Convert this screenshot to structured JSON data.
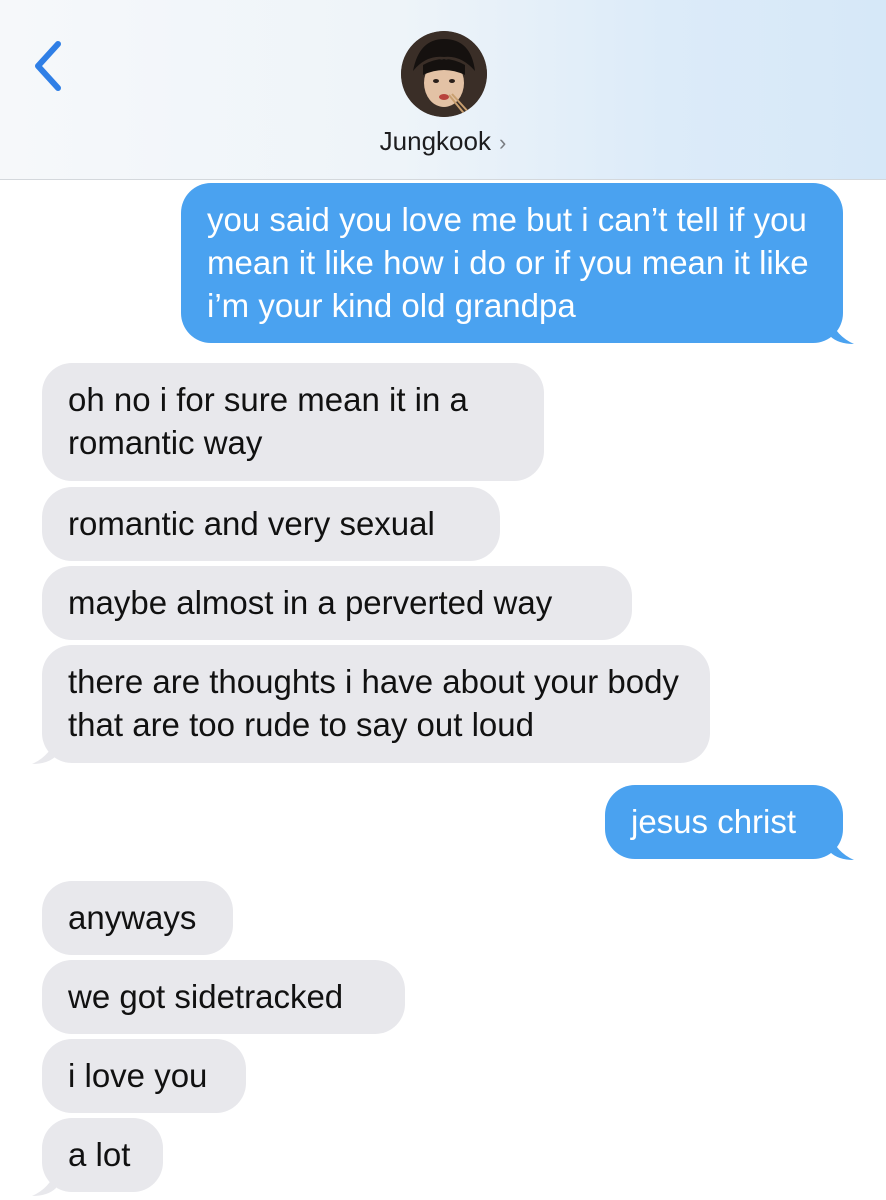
{
  "header": {
    "contact_name": "Jungkook",
    "chevron": "›"
  },
  "messages": [
    {
      "from": "me",
      "text": "you said you love me but i can’t tell if you mean it like how i do or if you mean it like i’m your kind old grandpa"
    },
    {
      "from": "them",
      "text": "oh no i for sure mean it in a romantic way"
    },
    {
      "from": "them",
      "text": "romantic and very sexual"
    },
    {
      "from": "them",
      "text": "maybe almost in a perverted way"
    },
    {
      "from": "them",
      "text": "there are thoughts i have about your body that are too rude to say out loud"
    },
    {
      "from": "me",
      "text": "jesus christ"
    },
    {
      "from": "them",
      "text": "anyways"
    },
    {
      "from": "them",
      "text": "we got sidetracked"
    },
    {
      "from": "them",
      "text": "i love you"
    },
    {
      "from": "them",
      "text": "a lot"
    }
  ],
  "colors": {
    "sent_bubble": "#4aa2f0",
    "received_bubble": "#e8e8ec",
    "accent": "#2f7fe6"
  },
  "icons": {
    "back": "chevron-left-icon",
    "avatar": "contact-photo"
  }
}
